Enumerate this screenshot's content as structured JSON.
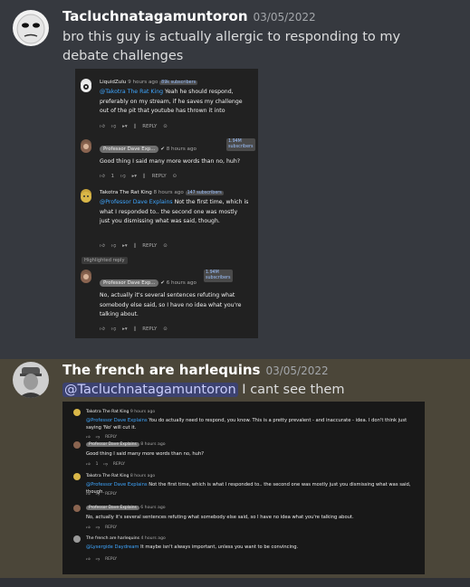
{
  "messages": [
    {
      "username": "Tacluchnatagamuntoron",
      "timestamp": "03/05/2022",
      "text": "bro this guy is actually allergic to responding to my debate challenges",
      "avatar_icon": "meme-face-avatar",
      "attachment": {
        "comments": [
          {
            "author": "LiquidZulu",
            "time": "9 hours ago",
            "subs": "89k subscribers",
            "mention": "@Takotra The Rat King",
            "text": " Yeah he should respond, preferably on my stream, if he saves my challenge out of the pit that youtube has thrown it into",
            "likes": "",
            "reply": "REPLY"
          },
          {
            "author": "Professor Dave Exp...",
            "time": "8 hours ago",
            "subs_line1": "1.94M",
            "subs_line2": "subscribers",
            "text": "Good thing I said many more words than no, huh?",
            "likes": "1",
            "reply": "REPLY"
          },
          {
            "author": "Takotra The Rat King",
            "time": "8 hours ago",
            "subs": "147 subscribers",
            "mention": "@Professor Dave Explains",
            "text": " Not the first time, which is what I responded to.. the second one was mostly just you dismissing what was said, though.",
            "likes": "",
            "reply": "REPLY"
          },
          {
            "author": "Professor Dave Exp...",
            "time": "6 hours ago",
            "subs_line1": "1.94M",
            "subs_line2": "subscribers",
            "text": "No, actually it's several sentences refuting what somebody else said, so I have no idea what you're talking about.",
            "likes": "",
            "reply": "REPLY"
          }
        ],
        "highlighted_label": "Highlighted reply"
      }
    },
    {
      "username": "The french are harlequins",
      "timestamp": "03/05/2022",
      "mention": "@Tacluchnatagamuntoron",
      "text": " I cant see them",
      "avatar_icon": "military-portrait-avatar",
      "attachment": {
        "comments": [
          {
            "author": "Takotra The Rat King",
            "time": "9 hours ago",
            "mention": "@Professor Dave Explains",
            "text": " You do actually need to respond, you know. This is a pretty prevalent - and inaccurate - idea. I don't think just saying 'No' will cut it.",
            "likes": "",
            "reply": "REPLY"
          },
          {
            "author": "Professor Dave Explains",
            "time": "8 hours ago",
            "text": "Good thing I said many more words than no, huh?",
            "likes": "1",
            "reply": "REPLY"
          },
          {
            "author": "Takotra The Rat King",
            "time": "8 hours ago",
            "mention": "@Professor Dave Explains",
            "text": " Not the first time, which is what I responded to.. the second one was mostly just you dismissing what was said, though.",
            "likes": "",
            "reply": "REPLY"
          },
          {
            "author": "Professor Dave Explains",
            "time": "6 hours ago",
            "text": "No, actually it's several sentences refuting what somebody else said, so I have no idea what you're talking about.",
            "likes": "",
            "reply": "REPLY"
          },
          {
            "author": "The french are harlequins",
            "time": "4 hours ago",
            "mention": "@Lysergide Daydream",
            "text": " It maybe isn't always important, unless you want to be convincing.",
            "likes": "",
            "reply": "REPLY"
          }
        ]
      }
    }
  ],
  "colors": {
    "background": "#36393f",
    "highlight_background": "#4b4639",
    "mention_bg": "#3c4270",
    "youtube_blue": "#3ea6ff"
  }
}
